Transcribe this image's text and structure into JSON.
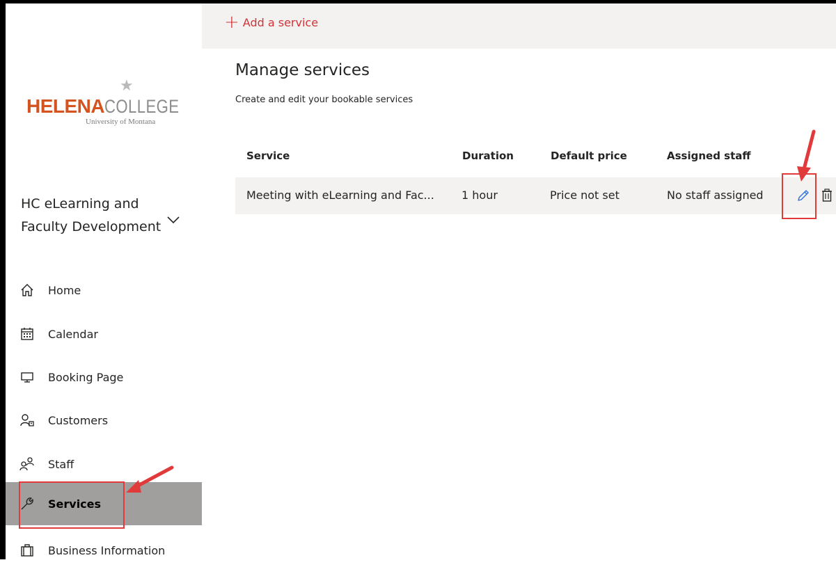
{
  "logo": {
    "primary": "HELENA",
    "secondary": "COLLEGE",
    "sub": "University of Montana"
  },
  "business_name": "HC eLearning and Faculty Development",
  "nav": [
    {
      "label": "Home",
      "icon": "home-icon"
    },
    {
      "label": "Calendar",
      "icon": "calendar-icon"
    },
    {
      "label": "Booking Page",
      "icon": "monitor-icon"
    },
    {
      "label": "Customers",
      "icon": "customers-icon"
    },
    {
      "label": "Staff",
      "icon": "staff-icon"
    },
    {
      "label": "Services",
      "icon": "wrench-icon",
      "active": true
    },
    {
      "label": "Business Information",
      "icon": "briefcase-icon"
    }
  ],
  "toolbar": {
    "add_label": "Add a service"
  },
  "page": {
    "title": "Manage services",
    "subtitle": "Create and edit your bookable services"
  },
  "table": {
    "columns": [
      "Service",
      "Duration",
      "Default price",
      "Assigned staff"
    ],
    "rows": [
      {
        "service": "Meeting with eLearning and Fac...",
        "duration": "1 hour",
        "price": "Price not set",
        "staff": "No staff assigned"
      }
    ]
  },
  "colors": {
    "accent": "#d13438",
    "active_nav": "#a19f9d",
    "annotation": "#e03a3a",
    "edit_icon": "#2b6fd6"
  }
}
